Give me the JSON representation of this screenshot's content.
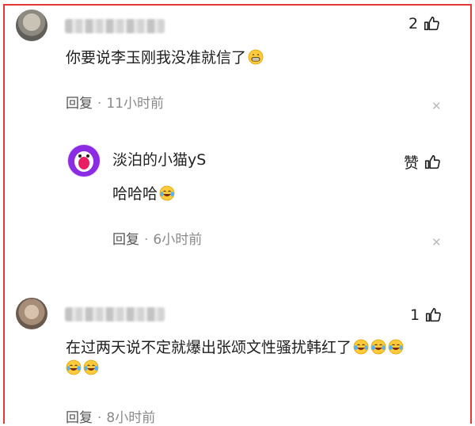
{
  "comments": [
    {
      "likes": "2",
      "text": "你要说李玉刚我没准就信了",
      "reply_label": "回复",
      "time": "11小时前",
      "replies": [
        {
          "username": "淡泊的小猫yS",
          "text": "哈哈哈",
          "like_label": "赞",
          "reply_label": "回复",
          "time": "6小时前"
        }
      ]
    },
    {
      "likes": "1",
      "text": "在过两天说不定就爆出张颂文性骚扰韩红了",
      "reply_label": "回复",
      "time": "8小时前"
    }
  ],
  "icons": {
    "like": "thumbs-up-icon",
    "close": "close-icon",
    "emoji_grin": "grinning-emoji",
    "emoji_laugh": "tears-of-joy-emoji"
  },
  "colors": {
    "border": "#e53935"
  }
}
